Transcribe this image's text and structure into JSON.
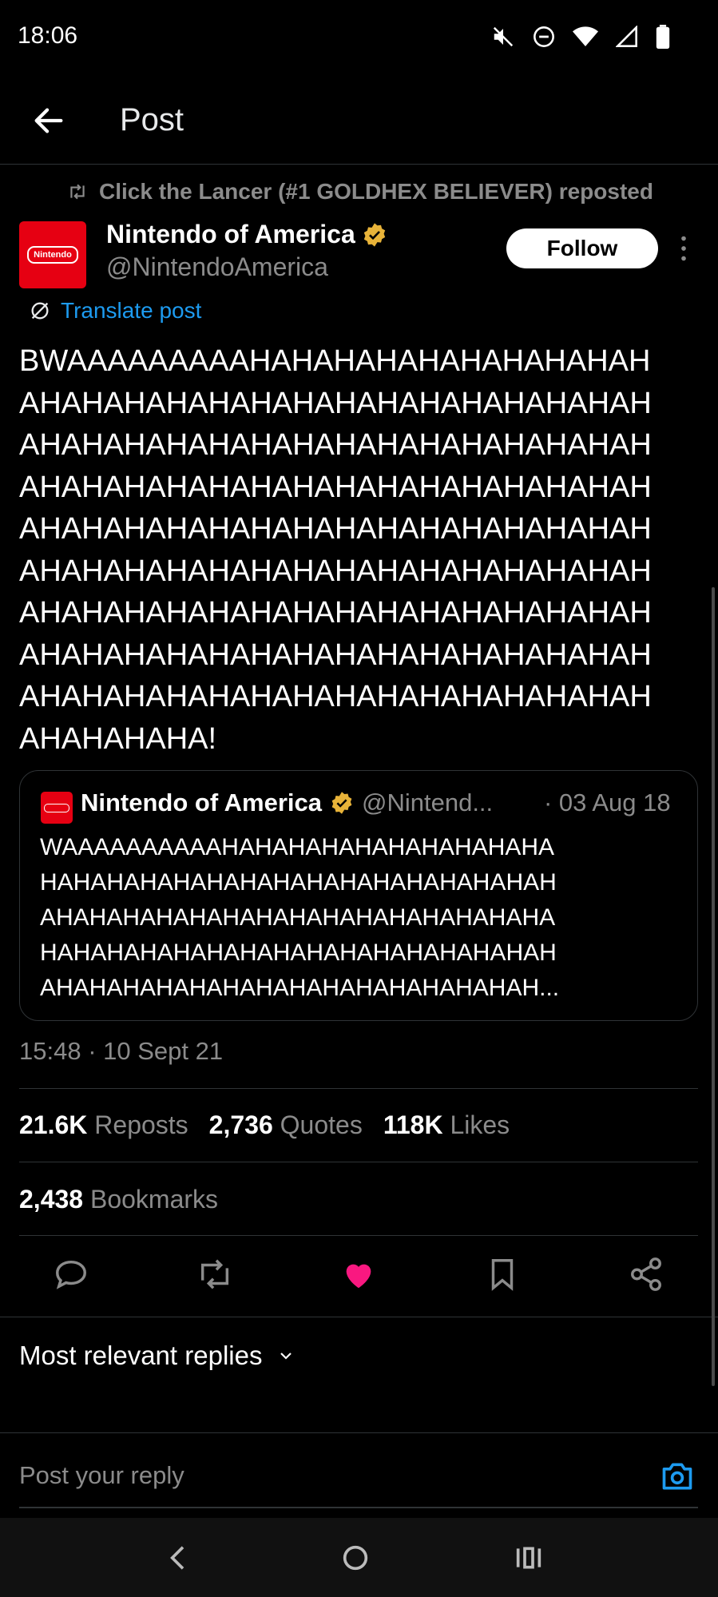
{
  "status_bar": {
    "time": "18:06",
    "icons": [
      "mute-icon",
      "dnd-icon",
      "wifi-icon",
      "signal-icon",
      "battery-icon"
    ]
  },
  "header": {
    "title": "Post"
  },
  "post": {
    "repost_text": "Click the Lancer (#1 GOLDHEX BELIEVER) reposted",
    "author_name": "Nintendo of America",
    "author_handle": "@NintendoAmerica",
    "follow_label": "Follow",
    "translate_label": "Translate post",
    "body_lines": [
      "BWAAAAAAAAAHAHAHAHAHAHAHAHAHAH",
      "AHAHAHAHAHAHAHAHAHAHAHAHAHAHAH",
      "AHAHAHAHAHAHAHAHAHAHAHAHAHAHAH",
      "AHAHAHAHAHAHAHAHAHAHAHAHAHAHAH",
      "AHAHAHAHAHAHAHAHAHAHAHAHAHAHAH",
      "AHAHAHAHAHAHAHAHAHAHAHAHAHAHAH",
      "AHAHAHAHAHAHAHAHAHAHAHAHAHAHAH",
      "AHAHAHAHAHAHAHAHAHAHAHAHAHAHAH",
      "AHAHAHAHAHAHAHAHAHAHAHAHAHAHAH",
      "AHAHAHAHA!"
    ],
    "quoted": {
      "author_name": "Nintendo of America",
      "author_handle": "@Nintend...",
      "date": "· 03 Aug 18",
      "lines": [
        "WAAAAAAAAAAHAHAHAHAHAHAHAHAHAHA",
        "HAHAHAHAHAHAHAHAHAHAHAHAHAHAHAH",
        "AHAHAHAHAHAHAHAHAHAHAHAHAHAHAHA",
        "HAHAHAHAHAHAHAHAHAHAHAHAHAHAHAH",
        "AHAHAHAHAHAHAHAHAHAHAHAHAHAHAH..."
      ]
    },
    "timestamp": "15:48 · 10 Sept 21",
    "stats": {
      "reposts_count": "21.6K",
      "reposts_label": "Reposts",
      "quotes_count": "2,736",
      "quotes_label": "Quotes",
      "likes_count": "118K",
      "likes_label": "Likes",
      "bookmarks_count": "2,438",
      "bookmarks_label": "Bookmarks"
    }
  },
  "replies": {
    "sort_label": "Most relevant replies",
    "input_placeholder": "Post your reply"
  },
  "colors": {
    "accent": "#1d9bf0",
    "like": "#f91880",
    "verified": "#e8b339",
    "brand": "#e60012"
  }
}
